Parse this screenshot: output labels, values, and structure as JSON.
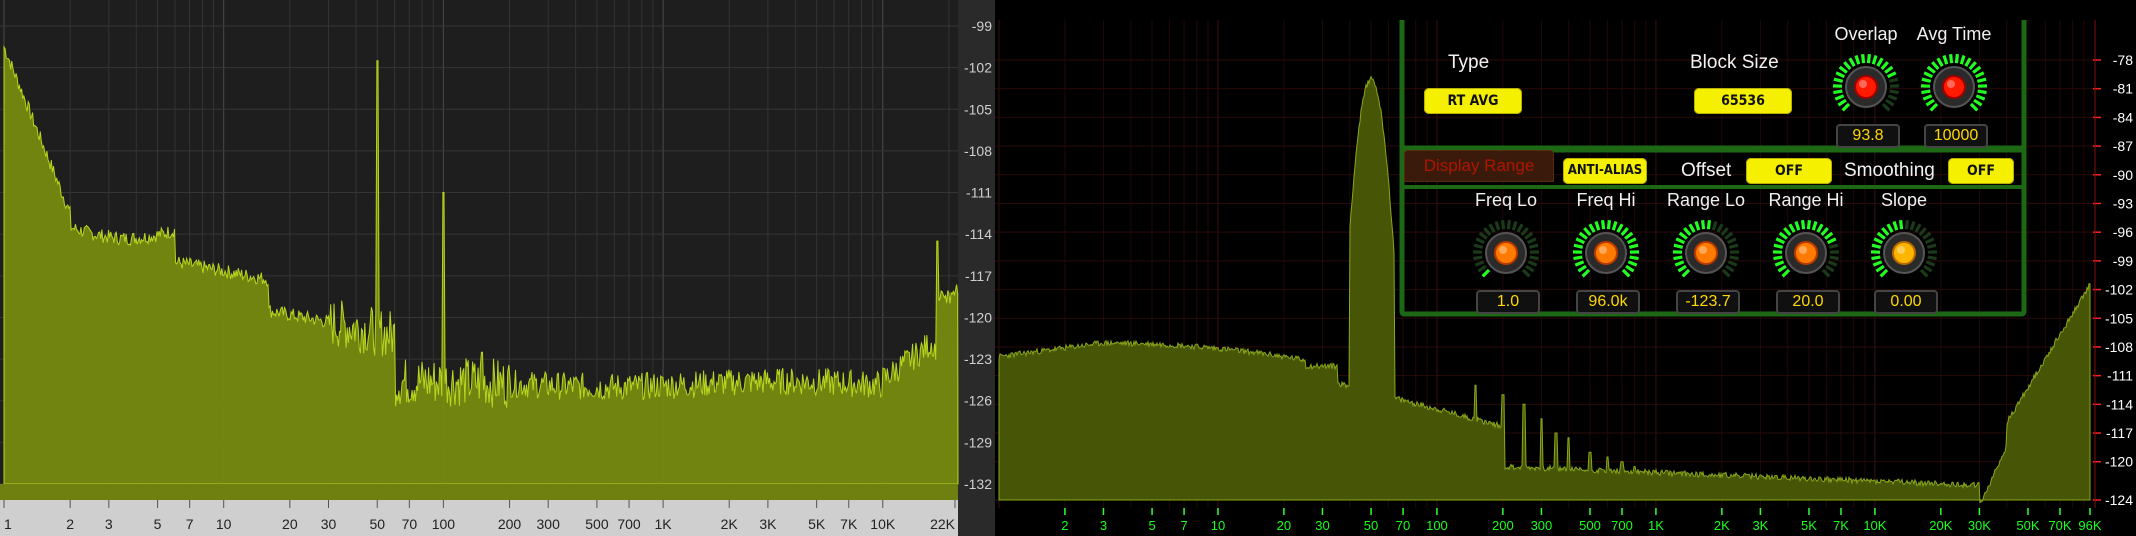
{
  "left_analyzer": {
    "y_ticks": [
      "-99",
      "-102",
      "-105",
      "-108",
      "-111",
      "-114",
      "-117",
      "-120",
      "-123",
      "-126",
      "-129",
      "-132"
    ],
    "x_ticks": [
      "1",
      "2",
      "3",
      "5",
      "7",
      "10",
      "20",
      "30",
      "50",
      "70",
      "100",
      "200",
      "300",
      "500",
      "700",
      "1K",
      "2K",
      "3K",
      "5K",
      "7K",
      "10K",
      "22K"
    ],
    "fill_color": "#778a10",
    "line_color": "#b8d61f"
  },
  "right_analyzer": {
    "y_ticks": [
      "-78",
      "-81",
      "-84",
      "-87",
      "-90",
      "-93",
      "-96",
      "-99",
      "-102",
      "-105",
      "-108",
      "-111",
      "-114",
      "-117",
      "-120",
      "-124"
    ],
    "x_ticks": [
      "2",
      "3",
      "5",
      "7",
      "10",
      "20",
      "30",
      "50",
      "70",
      "100",
      "200",
      "300",
      "500",
      "700",
      "1K",
      "2K",
      "3K",
      "5K",
      "7K",
      "10K",
      "20K",
      "30K",
      "50K",
      "70K",
      "96K"
    ],
    "tick_color": "#19ff19",
    "fill_color": "#4a5a06"
  },
  "controls": {
    "type_label": "Type",
    "type_value": "RT AVG",
    "block_size_label": "Block Size",
    "block_size_value": "65536",
    "tab_display_range": "Display Range",
    "anti_alias_label": "ANTI-ALIAS",
    "offset_label": "Offset",
    "offset_value": "OFF",
    "smoothing_label": "Smoothing",
    "smoothing_value": "OFF",
    "knobs": [
      {
        "title": "Overlap",
        "value": "93.8",
        "level": 0.75,
        "color": "red"
      },
      {
        "title": "Avg Time",
        "value": "10000",
        "level": 1.0,
        "color": "red"
      },
      {
        "title": "Freq Lo",
        "value": "1.0",
        "level": 0.0,
        "color": "orange"
      },
      {
        "title": "Freq Hi",
        "value": "96.0k",
        "level": 1.0,
        "color": "orange"
      },
      {
        "title": "Range Lo",
        "value": "-123.7",
        "level": 0.55,
        "color": "orange"
      },
      {
        "title": "Range Hi",
        "value": "20.0",
        "level": 0.75,
        "color": "orange"
      },
      {
        "title": "Slope",
        "value": "0.00",
        "level": 0.5,
        "color": "yellow"
      }
    ],
    "accent_green": "#1b5a12",
    "button_yellow": "#f4f000"
  }
}
